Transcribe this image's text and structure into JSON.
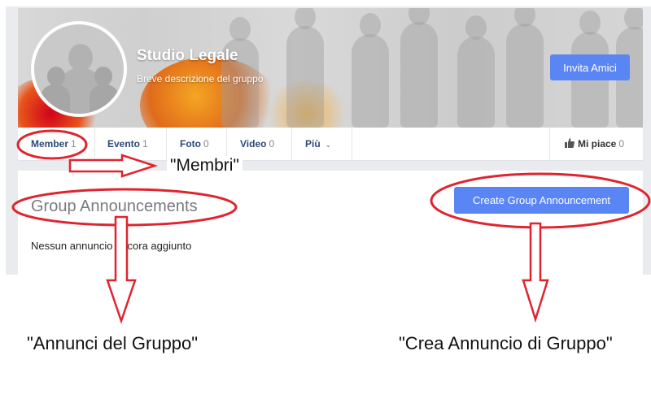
{
  "header": {
    "group_name": "Studio Legale",
    "group_description": "Breve descrizione del gruppo",
    "invite_label": "Invita Amici"
  },
  "tabs": [
    {
      "label": "Member",
      "count": "1"
    },
    {
      "label": "Evento",
      "count": "1"
    },
    {
      "label": "Foto",
      "count": "0"
    },
    {
      "label": "Video",
      "count": "0"
    },
    {
      "label": "Più"
    }
  ],
  "like": {
    "label": "Mi piace",
    "count": "0",
    "icon": "thumbs-up-icon"
  },
  "announcements": {
    "title": "Group Announcements",
    "create_label": "Create Group Announcement",
    "empty_text": "Nessun annuncio ancora aggiunto"
  },
  "annotations": {
    "membri": "\"Membri\"",
    "annunci": "\"Annunci del Gruppo\"",
    "crea": "\"Crea Annuncio di Gruppo\""
  },
  "colors": {
    "accent": "#5a86f5",
    "annotation": "#e0242f"
  }
}
